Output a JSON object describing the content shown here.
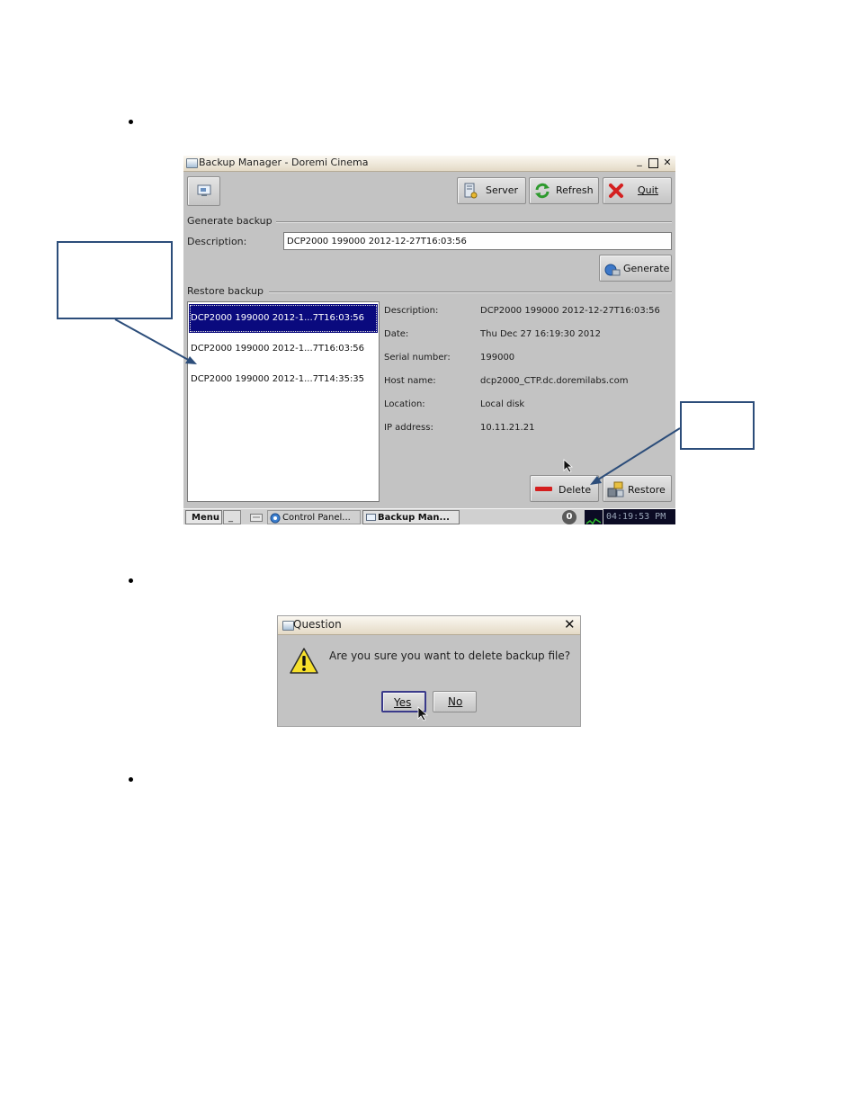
{
  "window": {
    "title": "Backup Manager - Doremi Cinema",
    "minimize": "_",
    "close": "✕"
  },
  "toolbar": {
    "server_label": "Server",
    "refresh_label": "Refresh",
    "quit_label": "Quit"
  },
  "generate": {
    "section_label": "Generate backup",
    "description_label": "Description:",
    "description_value": "DCP2000 199000 2012-12-27T16:03:56",
    "generate_label": "Generate"
  },
  "restore": {
    "section_label": "Restore backup",
    "backups": [
      {
        "label": "DCP2000 199000 2012-1...7T16:03:56",
        "selected": true
      },
      {
        "label": "DCP2000 199000 2012-1...7T16:03:56",
        "selected": false
      },
      {
        "label": "DCP2000 199000 2012-1...7T14:35:35",
        "selected": false
      }
    ],
    "details": [
      {
        "key": "Description:",
        "value": "DCP2000 199000 2012-12-27T16:03:56"
      },
      {
        "key": "Date:",
        "value": "Thu Dec 27 16:19:30 2012"
      },
      {
        "key": "Serial number:",
        "value": "199000"
      },
      {
        "key": "Host name:",
        "value": "dcp2000_CTP.dc.doremilabs.com"
      },
      {
        "key": "Location:",
        "value": "Local disk"
      },
      {
        "key": "IP address:",
        "value": "10.11.21.21"
      }
    ],
    "delete_label": "Delete",
    "restore_label": "Restore"
  },
  "taskbar": {
    "menu_label": "Menu",
    "minimize_label": "_",
    "control_panel_label": "Control Panel...",
    "backup_manager_label": "Backup Man...",
    "badge_count": "0",
    "clock": "04:19:53 PM"
  },
  "dialog": {
    "title": "Question",
    "close": "✕",
    "message": "Are you sure you want to delete backup file?",
    "yes_label": "Yes",
    "no_label": "No"
  },
  "colors": {
    "selection": "#0a0a7e",
    "window_bg": "#c3c3c3",
    "callout_border": "#2c4d7a"
  }
}
